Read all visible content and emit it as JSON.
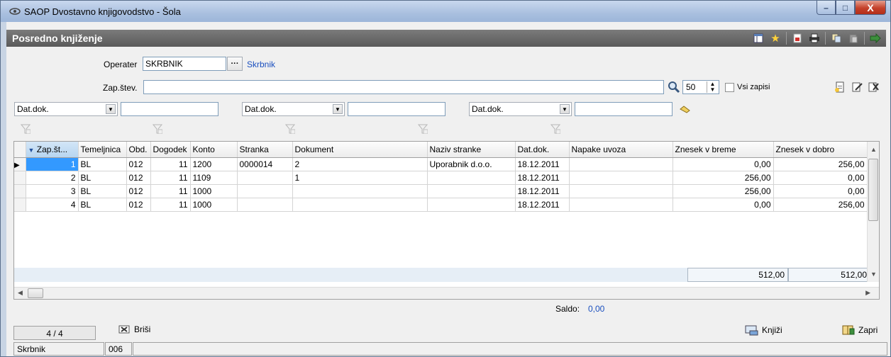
{
  "window": {
    "title": "SAOP Dvostavno knjigovodstvo - Šola",
    "controls": {
      "minimize": "–",
      "maximize": "□",
      "close": "X"
    }
  },
  "header": {
    "title": "Posredno knjiženje",
    "toolbar_icons": [
      "columns-icon",
      "favorite-star-icon",
      "pdf-export-icon",
      "print-icon",
      "copy-icon",
      "paste-icon",
      "exit-icon"
    ]
  },
  "form": {
    "operater_label": "Operater",
    "operater_value": "SKRBNIK",
    "operater_name": "Skrbnik",
    "zapstev_label": "Zap.štev.",
    "zapstev_value": "",
    "count_value": "50",
    "vsi_zapisi_label": "Vsi zapisi",
    "filters": [
      {
        "field": "Dat.dok.",
        "value": ""
      },
      {
        "field": "Dat.dok.",
        "value": ""
      },
      {
        "field": "Dat.dok.",
        "value": ""
      }
    ]
  },
  "grid": {
    "columns": [
      "Zap.št...",
      "Temeljnica",
      "Obd.",
      "Dogodek",
      "Konto",
      "Stranka",
      "Dokument",
      "Naziv stranke",
      "Dat.dok.",
      "Napake uvoza",
      "Znesek v breme",
      "Znesek v dobro"
    ],
    "rows": [
      [
        "1",
        "BL",
        "012",
        "11",
        "1200",
        "0000014",
        "2",
        "Uporabnik d.o.o.",
        "18.12.2011",
        "",
        "0,00",
        "256,00"
      ],
      [
        "2",
        "BL",
        "012",
        "11",
        "1109",
        "",
        "1",
        "",
        "18.12.2011",
        "",
        "256,00",
        "0,00"
      ],
      [
        "3",
        "BL",
        "012",
        "11",
        "1000",
        "",
        "",
        "",
        "18.12.2011",
        "",
        "256,00",
        "0,00"
      ],
      [
        "4",
        "BL",
        "012",
        "11",
        "1000",
        "",
        "",
        "",
        "18.12.2011",
        "",
        "0,00",
        "256,00"
      ]
    ],
    "total_breme": "512,00",
    "total_dobro": "512,00"
  },
  "footer": {
    "saldo_label": "Saldo:",
    "saldo_value": "0,00",
    "record_counter": "4 / 4",
    "brisi_label": "Briši",
    "knjizi_label": "Knjiži",
    "zapri_label": "Zapri"
  },
  "statusbar": {
    "user": "Skrbnik",
    "code": "006"
  }
}
